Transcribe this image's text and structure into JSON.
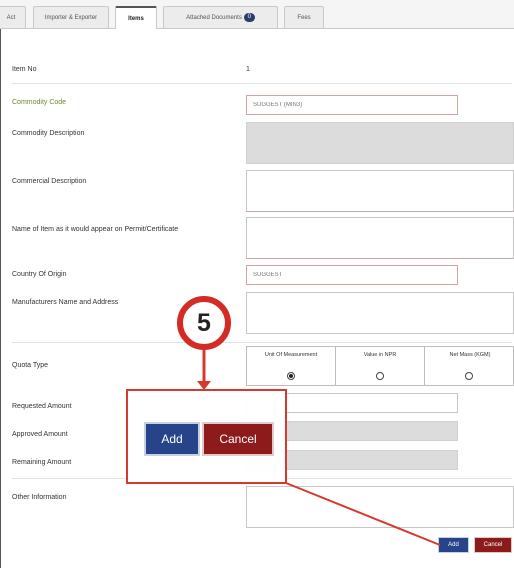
{
  "tabs": [
    {
      "label": "Act"
    },
    {
      "label": "Importer & Exporter"
    },
    {
      "label": "Items"
    },
    {
      "label": "Attached Documents",
      "badge": "0"
    },
    {
      "label": "Fees"
    }
  ],
  "form": {
    "item_no": {
      "label": "Item No",
      "value": "1"
    },
    "commodity_code": {
      "label": "Commodity Code",
      "placeholder": "SUGGEST (MIN3)"
    },
    "commodity_description": {
      "label": "Commodity Description"
    },
    "commercial_description": {
      "label": "Commercial Description"
    },
    "permit_name": {
      "label": "Name of Item as it would appear on Permit/Certificate"
    },
    "country_of_origin": {
      "label": "Country Of Origin",
      "placeholder": "SUGGEST"
    },
    "manufacturer": {
      "label": "Manufacturers Name and Address"
    },
    "quota_type": {
      "label": "Quota Type",
      "options": [
        {
          "label": "Unit Of Measurement",
          "selected": true
        },
        {
          "label": "Value in NPR",
          "selected": false
        },
        {
          "label": "Net Mass (KGM)",
          "selected": false
        }
      ]
    },
    "requested_amount": {
      "label": "Requested Amount"
    },
    "approved_amount": {
      "label": "Approved Amount"
    },
    "remaining_amount": {
      "label": "Remaining Amount"
    },
    "other_information": {
      "label": "Other Information"
    }
  },
  "buttons": {
    "add": "Add",
    "cancel": "Cancel"
  },
  "callout": {
    "step": "5"
  },
  "colors": {
    "add": "#27448a",
    "cancel": "#8d1b1b",
    "highlight": "#d63a2f"
  }
}
